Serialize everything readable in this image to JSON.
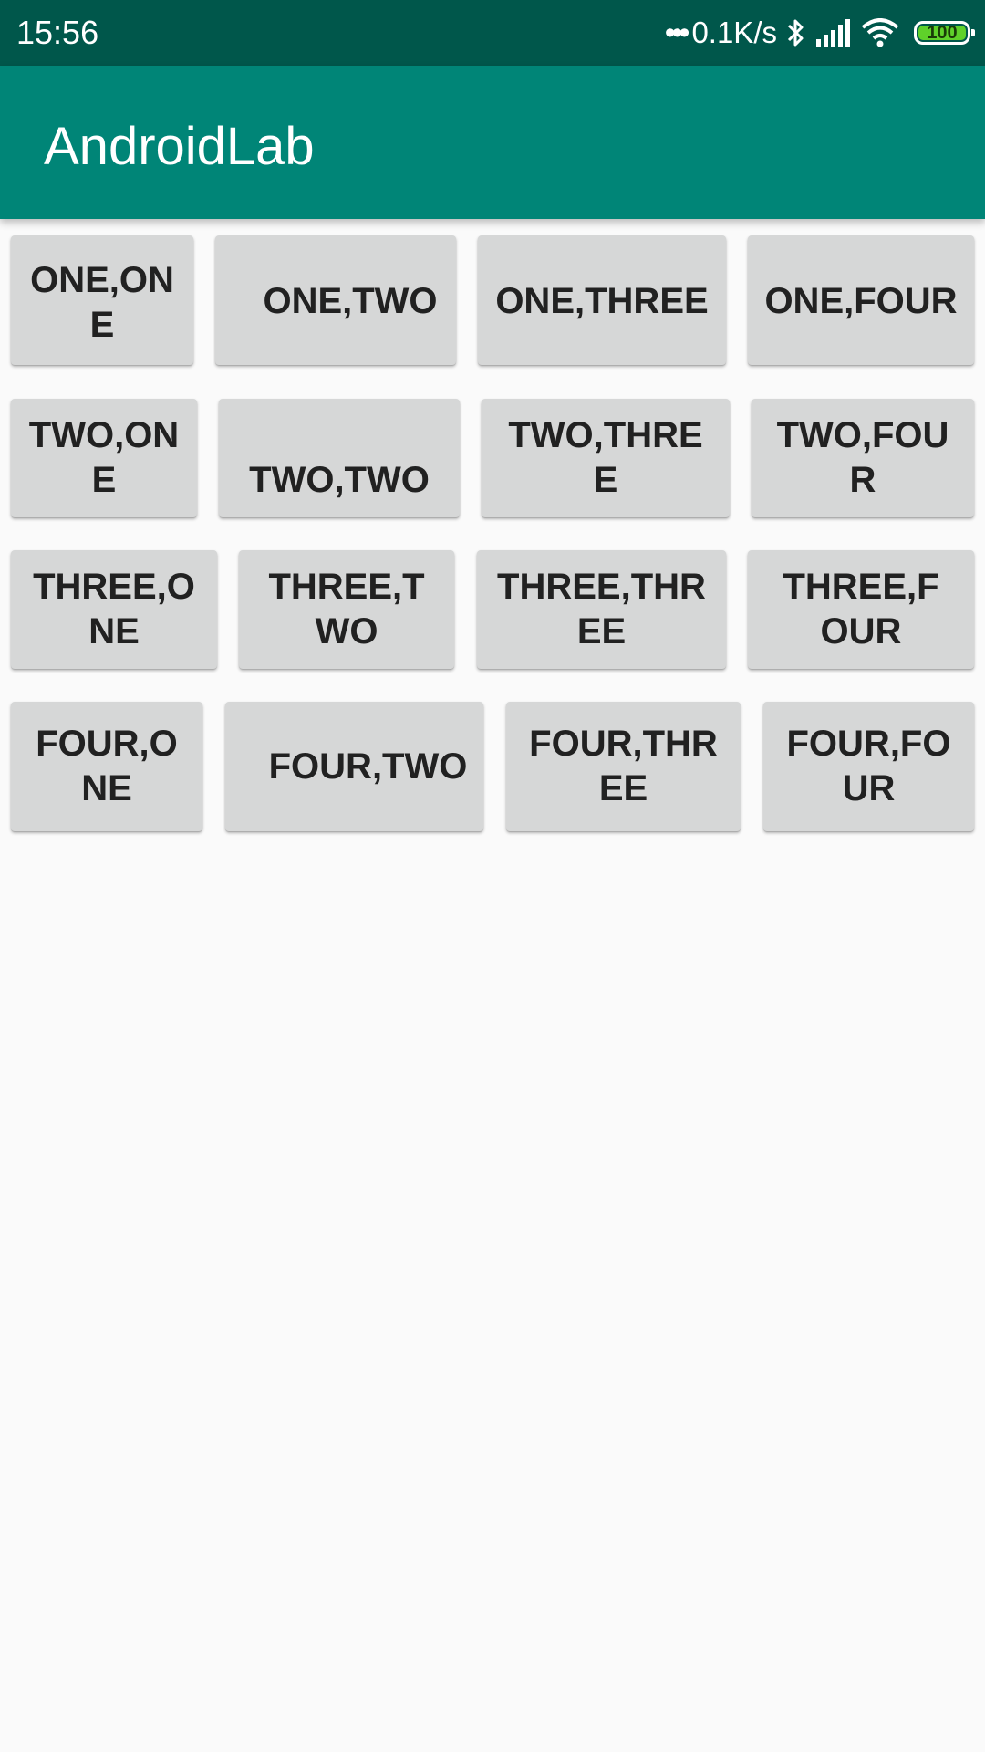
{
  "status_bar": {
    "time": "15:56",
    "net_speed": "0.1K/s",
    "battery_level": "100",
    "icons": [
      "dots-icon",
      "bluetooth-icon",
      "signal-icon",
      "wifi-icon",
      "battery-icon"
    ],
    "background_color": "#00574b"
  },
  "app_bar": {
    "title": "AndroidLab",
    "background_color": "#008577"
  },
  "grid": {
    "buttons": [
      [
        "ONE,ONE",
        "ONE,TWO",
        "ONE,THREE",
        "ONE,FOUR"
      ],
      [
        "TWO,ONE",
        "TWO,TWO",
        "TWO,THREE",
        "TWO,FOUR"
      ],
      [
        "THREE,ONE",
        "THREE,TWO",
        "THREE,THREE",
        "THREE,FOUR"
      ],
      [
        "FOUR,ONE",
        "FOUR,TWO",
        "FOUR,THREE",
        "FOUR,FOUR"
      ]
    ],
    "button_color": "#d6d7d7",
    "text_color": "#212121"
  }
}
